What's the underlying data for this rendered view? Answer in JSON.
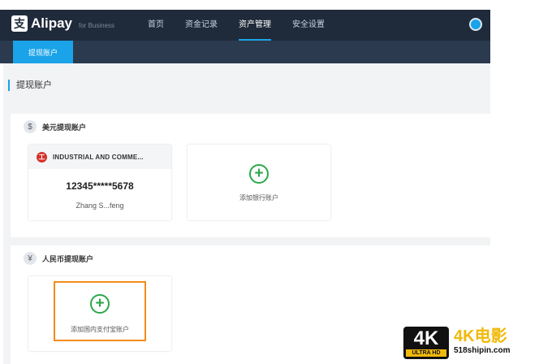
{
  "header": {
    "logo_glyph": "支",
    "logo_text": "Alipay",
    "logo_sub": "for Business",
    "nav": [
      "首页",
      "资金记录",
      "资产管理",
      "安全设置"
    ],
    "active_nav": "资产管理"
  },
  "subnav": {
    "active_tab": "提现账户"
  },
  "page": {
    "title": "提现账户"
  },
  "usd_section": {
    "icon": "$",
    "title": "美元提现账户",
    "bank_card": {
      "bank_icon_glyph": "工",
      "bank_name": "INDUSTRIAL AND COMME...",
      "account_number": "12345*****5678",
      "holder_name": "Zhang S...feng"
    },
    "add_bank_label": "添加银行账户"
  },
  "cny_section": {
    "icon": "¥",
    "title": "人民币提现账户",
    "add_alipay_label": "添加国内支付宝账户"
  },
  "plus_glyph": "+",
  "watermark": {
    "badge_text": "4K",
    "badge_sub": "ULTRA HD",
    "title": "4K电影",
    "url": "518shipin.com"
  },
  "colors": {
    "header_bg": "#1f2a3a",
    "accent": "#1aa3e8",
    "plus_green": "#2aa84a",
    "highlight": "#f28c1b",
    "bank_icon": "#d6322c"
  }
}
